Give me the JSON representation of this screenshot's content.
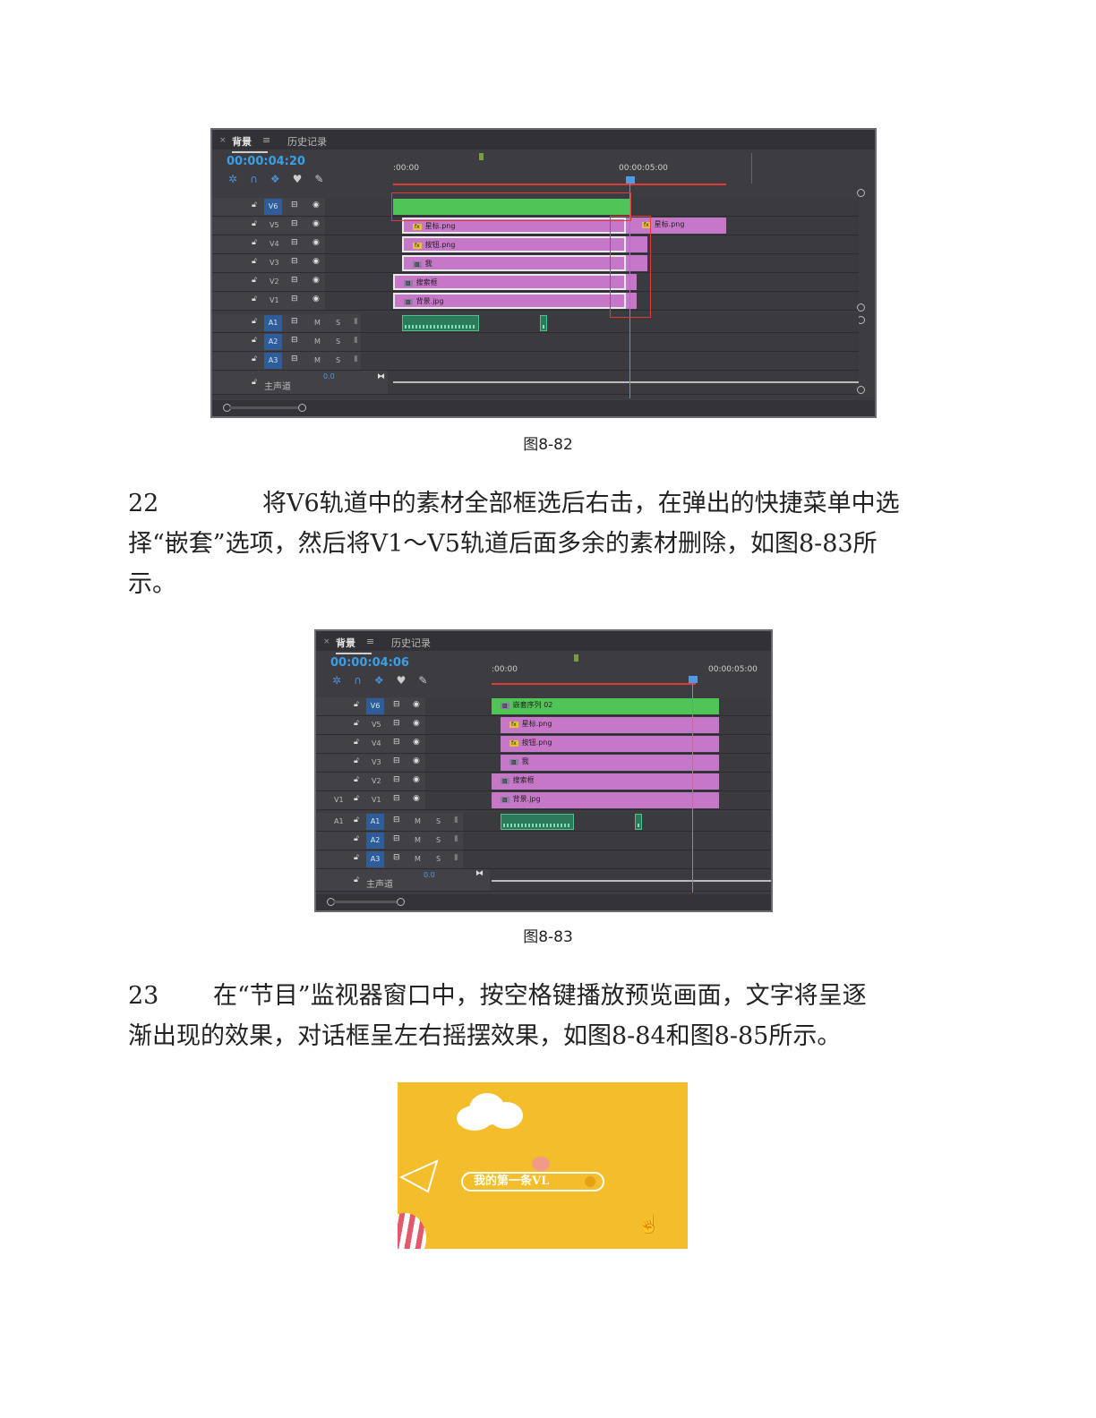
{
  "figure1": {
    "panel_tab": "背景",
    "menu_icon": "≡",
    "history_tab": "历史记录",
    "timecode": "00:00:04:20",
    "ruler_start": ":00:00",
    "ruler_mark": "00:00:05:00",
    "video_tracks": [
      "V6",
      "V5",
      "V4",
      "V3",
      "V2",
      "V1"
    ],
    "audio_tracks": [
      "A1",
      "A2",
      "A3"
    ],
    "audio_m": "M",
    "audio_s": "S",
    "master_label": "主声道",
    "master_value": "0.0",
    "clips": {
      "v5": "星标.png",
      "v5_after": "星标.png",
      "v4": "按钮.png",
      "v3": "我",
      "v2": "搜索框",
      "v1": "背景.jpg"
    },
    "caption": "图8-82"
  },
  "step22": {
    "number": "22",
    "line1": "将V6轨道中的素材全部框选后右击，在弹出的快捷菜单中选",
    "line2": "择“嵌套”选项，然后将V1～V5轨道后面多余的素材删除，如图8-83所",
    "line3": "示。"
  },
  "figure2": {
    "panel_tab": "背景",
    "menu_icon": "≡",
    "history_tab": "历史记录",
    "timecode": "00:00:04:06",
    "ruler_start": ":00:00",
    "ruler_mark": "00:00:05:00",
    "video_tracks": [
      "V6",
      "V5",
      "V4",
      "V3",
      "V2",
      "V1"
    ],
    "audio_tracks": [
      "A1",
      "A2",
      "A3"
    ],
    "src_v1": "V1",
    "src_a1": "A1",
    "audio_m": "M",
    "audio_s": "S",
    "master_label": "主声道",
    "master_value": "0.0",
    "clips": {
      "v6": "嵌套序列 02",
      "v5": "星标.png",
      "v4": "按钮.png",
      "v3": "我",
      "v2": "搜索框",
      "v1": "背景.jpg"
    },
    "caption": "图8-83"
  },
  "step23": {
    "number": "23",
    "line1": "在“节目”监视器窗口中，按空格键播放预览画面，文字将呈逐",
    "line2": "渐出现的效果，对话框呈左右摇摆效果，如图8-84和图8-85所示。"
  },
  "preview": {
    "search_text": "我的第一条VL",
    "colors": {
      "background": "#f3bd2c",
      "search_button": "#e5a217"
    }
  },
  "colors": {
    "timeline_bg": "#3c3c41",
    "timecode": "#3aa0e8",
    "video_clip_green": "#50c457",
    "video_clip_pink": "#c677c8",
    "track_button": "#2f5d99",
    "work_area_red": "#e03b3b"
  }
}
